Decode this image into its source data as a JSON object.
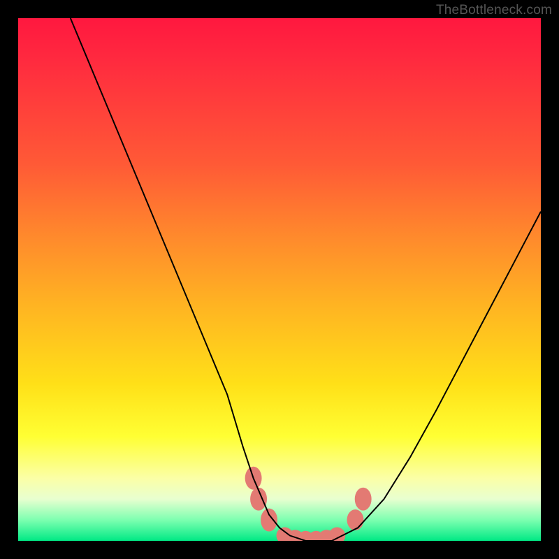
{
  "watermark": "TheBottleneck.com",
  "chart_data": {
    "type": "line",
    "title": "",
    "xlabel": "",
    "ylabel": "",
    "xlim": [
      0,
      100
    ],
    "ylim": [
      0,
      100
    ],
    "grid": false,
    "series": [
      {
        "name": "curve",
        "x": [
          10,
          15,
          20,
          25,
          30,
          35,
          40,
          43,
          45,
          48,
          50,
          52,
          55,
          58,
          60,
          62,
          65,
          70,
          75,
          80,
          85,
          90,
          95,
          100
        ],
        "values": [
          100,
          88,
          76,
          64,
          52,
          40,
          28,
          18,
          12,
          5,
          2.5,
          1,
          0,
          0,
          0,
          1,
          2.5,
          8,
          16,
          25,
          34.5,
          44,
          53.5,
          63
        ]
      }
    ],
    "markers": [
      {
        "x": 45,
        "y": 12,
        "rx": 1.6,
        "ry": 2.2
      },
      {
        "x": 46,
        "y": 8,
        "rx": 1.6,
        "ry": 2.2
      },
      {
        "x": 48,
        "y": 4,
        "rx": 1.6,
        "ry": 2.2
      },
      {
        "x": 51,
        "y": 1,
        "rx": 1.6,
        "ry": 1.6
      },
      {
        "x": 53,
        "y": 0.5,
        "rx": 1.6,
        "ry": 1.6
      },
      {
        "x": 55,
        "y": 0.3,
        "rx": 1.6,
        "ry": 1.6
      },
      {
        "x": 57,
        "y": 0.3,
        "rx": 1.6,
        "ry": 1.6
      },
      {
        "x": 59,
        "y": 0.5,
        "rx": 1.6,
        "ry": 1.6
      },
      {
        "x": 61,
        "y": 1,
        "rx": 1.6,
        "ry": 1.6
      },
      {
        "x": 64.5,
        "y": 4,
        "rx": 1.6,
        "ry": 2.0
      },
      {
        "x": 66,
        "y": 8,
        "rx": 1.6,
        "ry": 2.2
      }
    ],
    "colors": {
      "curve_stroke": "#000000",
      "marker_fill": "#e37a73"
    }
  }
}
